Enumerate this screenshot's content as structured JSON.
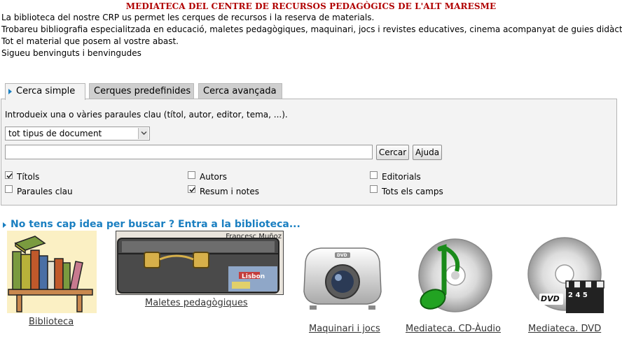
{
  "header": {
    "title": "MEDIATECA DEL CENTRE DE RECURSOS PEDAGÒGICS DE L'ALT MARESME",
    "intro_lines": [
      "La biblioteca del nostre CRP us permet les cerques de recursos i la reserva de materials.",
      "Trobareu bibliografia especialitzada en educació, maletes pedagògiques, maquinari, jocs i revistes educatives, cinema acompanyat de guies didàctiques...",
      "Tot el material que posem al vostre abast.",
      "Sigueu benvinguts i benvingudes"
    ]
  },
  "tabs": [
    {
      "label": "Cerca simple",
      "active": true
    },
    {
      "label": "Cerques predefinides",
      "active": false
    },
    {
      "label": "Cerca avançada",
      "active": false
    }
  ],
  "search": {
    "hint": "Introdueix una o vàries paraules clau (títol, autor, editor, tema, ...).",
    "doc_type_selected": "tot tipus de document",
    "query_value": "",
    "search_button": "Cercar",
    "help_button": "Ajuda",
    "fields": [
      {
        "label": "Títols",
        "checked": true
      },
      {
        "label": "Autors",
        "checked": false
      },
      {
        "label": "Editorials",
        "checked": false
      },
      {
        "label": "Paraules clau",
        "checked": false
      },
      {
        "label": "Resum i notes",
        "checked": true
      },
      {
        "label": "Tots els camps",
        "checked": false
      }
    ]
  },
  "library": {
    "heading": "No tens cap idea per buscar ? Entra a la biblioteca...",
    "items": [
      {
        "label": "Biblioteca",
        "icon": "bookshelf-icon"
      },
      {
        "label": "Maletes pedagògiques",
        "icon": "suitcase-icon",
        "image_caption": "Francesc Muñoz",
        "sticker_text": "Lisbon"
      },
      {
        "label": "Maquinari i jocs",
        "icon": "projector-icon",
        "projector_badge": "DVD"
      },
      {
        "label": "Mediateca. CD-Àudio",
        "icon": "music-cd-icon"
      },
      {
        "label": "Mediateca. DVD",
        "icon": "dvd-clapper-icon",
        "disc_label": "DVD",
        "clapper_digits": "2 4 5"
      }
    ]
  },
  "colors": {
    "title_red": "#b00000",
    "accent_blue": "#1a7fc1",
    "panel_bg": "#f3f3f3",
    "tab_inactive": "#cfcfcf"
  }
}
